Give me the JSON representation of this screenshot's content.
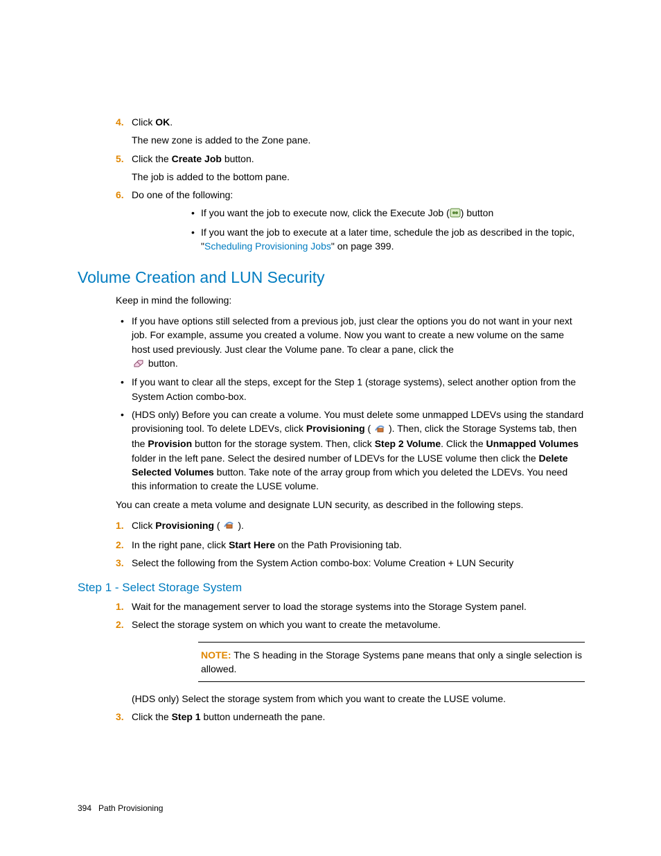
{
  "steps_a": {
    "s4": {
      "num": "4.",
      "p1a": "Click ",
      "p1b": "OK",
      "p1c": ".",
      "p2": "The new zone is added to the Zone pane."
    },
    "s5": {
      "num": "5.",
      "p1a": "Click the ",
      "p1b": "Create Job",
      "p1c": " button.",
      "p2": "The job is added to the bottom pane."
    },
    "s6": {
      "num": "6.",
      "p1": "Do one of the following:",
      "b1a": "If you want the job to execute now, click the Execute Job (",
      "b1b": ") button",
      "b2a": "If you want the job to execute at a later time, schedule the job as described in the topic, \"",
      "b2link": "Scheduling Provisioning Jobs",
      "b2b": "\" on page 399."
    }
  },
  "h2": "Volume Creation and LUN Security",
  "intro": "Keep in mind the following:",
  "bullets": {
    "b1a": "If you have options still selected from a previous job, just clear the options you do not want in your next job. For example, assume you created a volume. Now you want to create a new volume on the same host used previously. Just clear the Volume pane. To clear a pane, click the ",
    "b1b": " button.",
    "b2": "If you want to clear all the steps, except for the Step 1 (storage systems), select another option from the System Action combo-box.",
    "b3a": "(HDS only) Before you can create a volume. You must delete some unmapped LDEVs using the standard provisioning tool. To delete LDEVs, click ",
    "b3b": "Provisioning",
    "b3c": " ( ",
    "b3d": " ). Then, click the Storage Systems tab, then the ",
    "b3e": "Provision",
    "b3f": " button for the storage system. Then, click ",
    "b3g": "Step 2 Volume",
    "b3h": ". Click the ",
    "b3i": "Unmapped Volumes",
    "b3j": " folder in the left pane. Select the desired number of LDEVs for the LUSE volume then click the ",
    "b3k": "Delete Selected Volumes",
    "b3l": " button. Take note of the array group from which you deleted the LDEVs. You need this information to create the LUSE volume."
  },
  "after_bullets": "You can create a meta volume and designate LUN security, as described in the following steps.",
  "steps_b": {
    "s1": {
      "num": "1.",
      "a": "Click ",
      "b": "Provisioning",
      "c": " ( ",
      "d": " )."
    },
    "s2": {
      "num": "2.",
      "a": "In the right pane, click ",
      "b": "Start Here",
      "c": " on the Path Provisioning tab."
    },
    "s3": {
      "num": "3.",
      "a": "Select the following from the System Action combo-box: Volume Creation + LUN Security"
    }
  },
  "h3": "Step 1 - Select Storage System",
  "steps_c": {
    "s1": {
      "num": "1.",
      "a": "Wait for the management server to load the storage systems into the Storage System panel."
    },
    "s2": {
      "num": "2.",
      "a": "Select the storage system on which you want to create the metavolume."
    },
    "note_label": "NOTE:",
    "note_text": "   The S heading in the Storage Systems pane means that only a single selection is allowed.",
    "after_note": "(HDS only) Select the storage system from which you want to create the LUSE volume.",
    "s3": {
      "num": "3.",
      "a": "Click the ",
      "b": "Step 1",
      "c": " button underneath the pane."
    }
  },
  "footer": {
    "page": "394",
    "title": "Path Provisioning"
  }
}
